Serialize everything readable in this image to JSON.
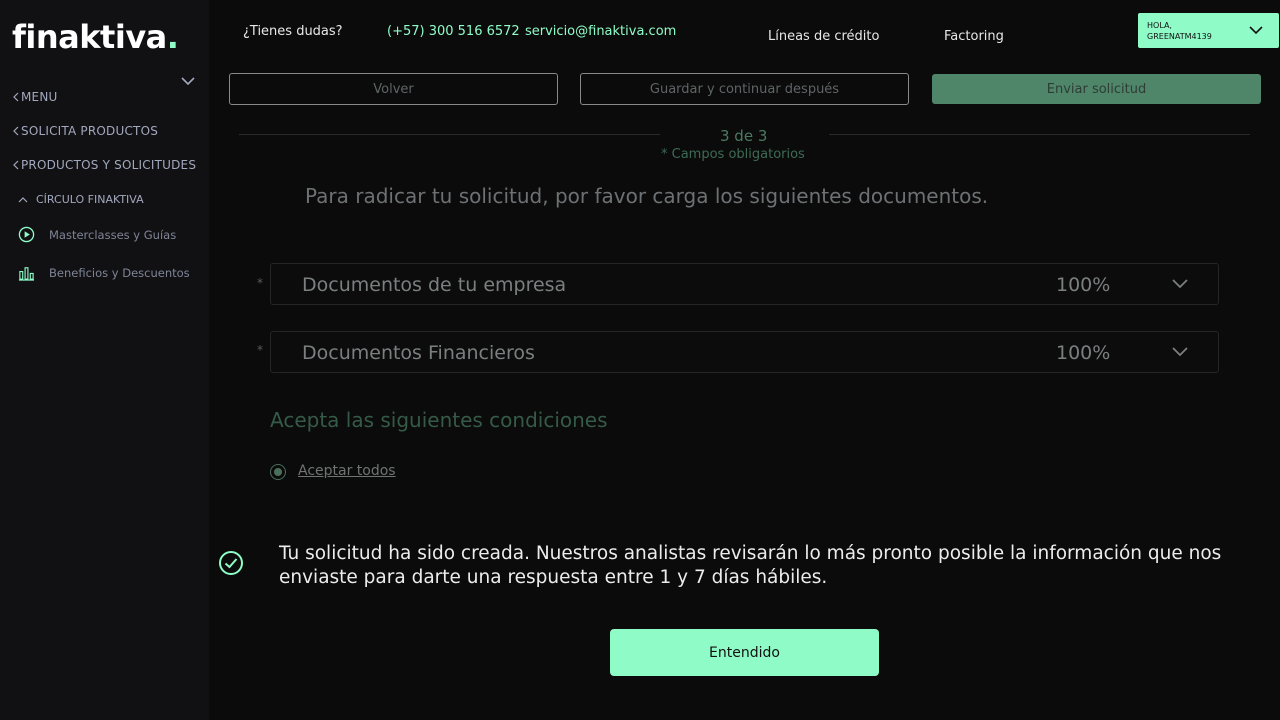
{
  "brand": {
    "name": "finaktiva",
    "dot": ".",
    "accent": "#8ffcc8"
  },
  "sidebar": {
    "menu": "MENU",
    "items": [
      {
        "label": "SOLICITA PRODUCTOS"
      },
      {
        "label": "PRODUCTOS Y SOLICITUDES"
      }
    ],
    "section": "CÍRCULO FINAKTIVA",
    "subitems": [
      {
        "label": "Masterclasses y Guías",
        "icon": "play-circle-icon"
      },
      {
        "label": "Beneficios y Descuentos",
        "icon": "benefits-icon"
      }
    ]
  },
  "header": {
    "question": "¿Tienes dudas?",
    "phone": "(+57) 300 516 6572",
    "email": "servicio@finaktiva.com",
    "nav": [
      "Líneas de crédito",
      "Factoring"
    ],
    "user_greeting": "HOLA,",
    "user_name": "GREENATM4139"
  },
  "actions": {
    "back": "Volver",
    "save": "Guardar y continuar después",
    "send": "Enviar solicitud"
  },
  "form": {
    "step": "3 de 3",
    "required_note": "* Campos obligatorios",
    "instructions": "Para radicar tu solicitud, por favor carga los siguientes documentos.",
    "sections": [
      {
        "asterisk": "*",
        "title": "Documentos de tu empresa",
        "progress": "100%"
      },
      {
        "asterisk": "*",
        "title": "Documentos Financieros",
        "progress": "100%"
      }
    ],
    "conditions_title": "Acepta las siguientes condiciones",
    "accept_all": "Aceptar todos"
  },
  "modal": {
    "message": "Tu solicitud ha sido creada. Nuestros analistas revisarán lo más pronto posible la información que nos enviaste para darte una respuesta entre 1 y 7 días hábiles.",
    "confirm": "Entendido"
  }
}
